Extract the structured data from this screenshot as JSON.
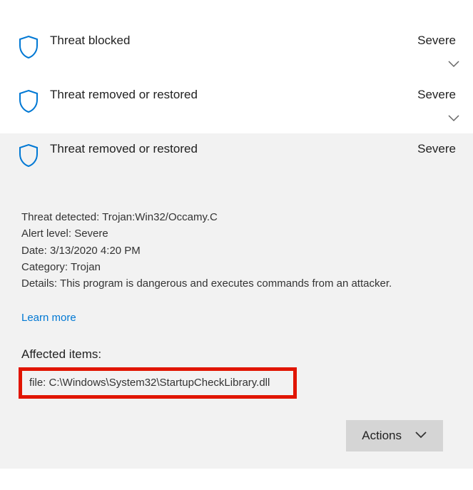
{
  "threats": [
    {
      "title": "Threat blocked",
      "severity": "Severe"
    },
    {
      "title": "Threat removed or restored",
      "severity": "Severe"
    },
    {
      "title": "Threat removed or restored",
      "severity": "Severe"
    }
  ],
  "details": {
    "threat_detected_label": "Threat detected:",
    "threat_detected_value": "Trojan:Win32/Occamy.C",
    "alert_level_label": "Alert level:",
    "alert_level_value": "Severe",
    "date_label": "Date:",
    "date_value": "3/13/2020 4:20 PM",
    "category_label": "Category:",
    "category_value": "Trojan",
    "details_label": "Details:",
    "details_value": "This program is dangerous and executes commands from an attacker."
  },
  "learn_more_label": "Learn more",
  "affected_heading": "Affected items:",
  "affected_file": "file: C:\\Windows\\System32\\StartupCheckLibrary.dll",
  "actions_label": "Actions"
}
